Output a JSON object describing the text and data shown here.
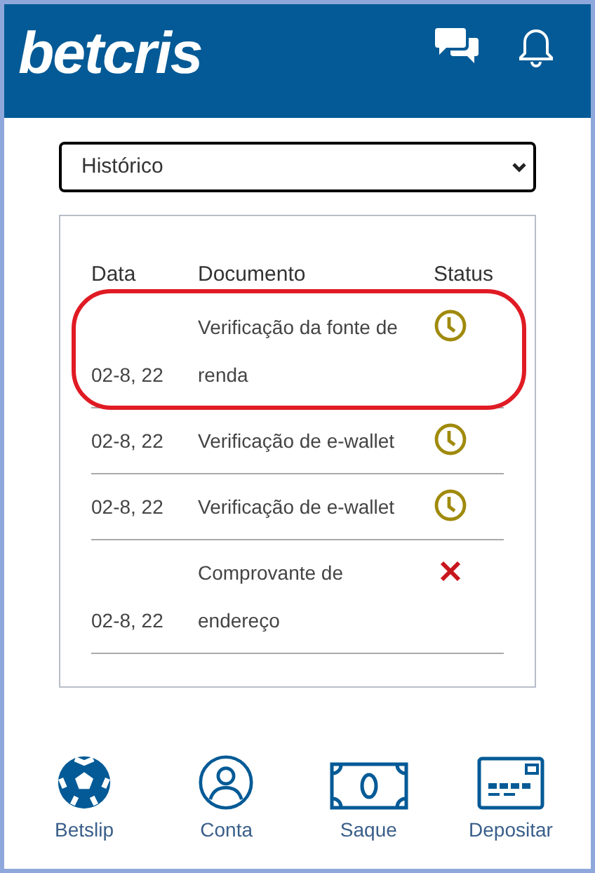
{
  "header": {
    "logo": "betcris"
  },
  "filter": {
    "value": "Histórico"
  },
  "table": {
    "columns": [
      "Data",
      "Documento",
      "Status"
    ],
    "rows": [
      {
        "date": "02-8, 22",
        "document": "Verificação da fonte de renda",
        "kind": "pending",
        "highlighted": true
      },
      {
        "date": "02-8, 22",
        "document": "Verificação de e-wallet",
        "kind": "pending",
        "highlighted": false
      },
      {
        "date": "02-8, 22",
        "document": "Verificação de e-wallet",
        "kind": "pending",
        "highlighted": false
      },
      {
        "date": "02-8, 22",
        "document": "Comprovante de endereço",
        "kind": "rejected",
        "highlighted": false
      }
    ]
  },
  "nav": [
    {
      "kind": "ball",
      "label": "Betslip"
    },
    {
      "kind": "user",
      "label": "Conta"
    },
    {
      "kind": "cash",
      "label": "Saque"
    },
    {
      "kind": "card",
      "label": "Depositar"
    }
  ]
}
